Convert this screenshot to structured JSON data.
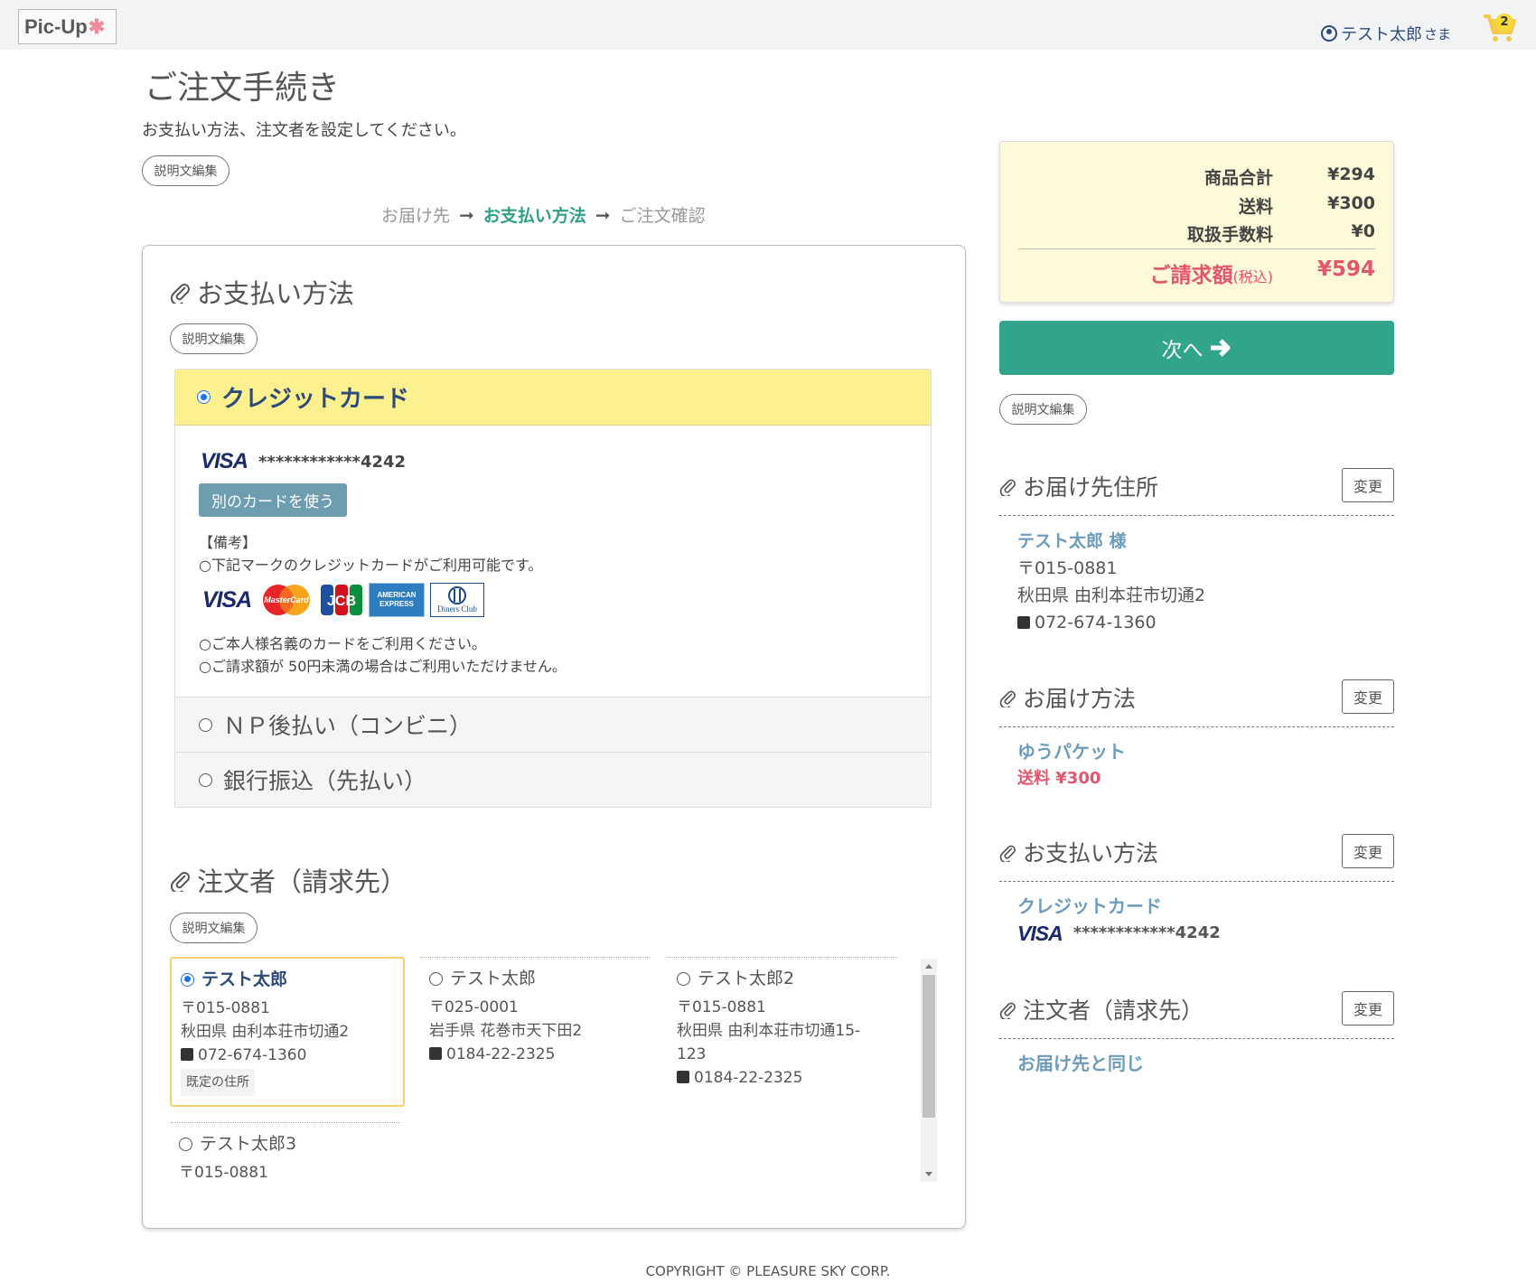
{
  "header": {
    "logo_text": "Pic-Up",
    "user_name": "テスト太郎",
    "user_suffix": "さま",
    "cart_count": "2"
  },
  "page": {
    "title": "ご注文手続き",
    "intro": "お支払い方法、注文者を設定してください。",
    "edit_label": "説明文編集"
  },
  "steps": {
    "step1": "お届け先",
    "step2": "お支払い方法",
    "step3": "ご注文確認",
    "arrow": "➞"
  },
  "payment": {
    "title": "お支払い方法",
    "edit_label": "説明文編集",
    "selected_label": "クレジットカード",
    "card_brand": "VISA",
    "card_number": "************4242",
    "alt_card_button": "別のカードを使う",
    "note_head": "【備考】",
    "note1": "○下記マークのクレジットカードがご利用可能です。",
    "note2": "○ご本人様名義のカードをご利用ください。",
    "note3": "○ご請求額が 50円未満の場合はご利用いただけません。",
    "brands": {
      "visa": "VISA",
      "mc": "MasterCard",
      "jcb": "JCB",
      "amex1": "AMERICAN",
      "amex2": "EXPRESS",
      "diners": "Diners Club"
    },
    "opt2": "ＮＰ後払い（コンビニ）",
    "opt3": "銀行振込（先払い）"
  },
  "orderer": {
    "title": "注文者（請求先）",
    "edit_label": "説明文編集",
    "addresses": [
      {
        "name": "テスト太郎",
        "zip": "〒015-0881",
        "addr": "秋田県 由利本荘市切通2",
        "tel": "072-674-1360",
        "default": "既定の住所"
      },
      {
        "name": "テスト太郎",
        "zip": "〒025-0001",
        "addr": "岩手県 花巻市天下田2",
        "tel": "0184-22-2325"
      },
      {
        "name": "テスト太郎2",
        "zip": "〒015-0881",
        "addr": "秋田県 由利本荘市切通15-123",
        "tel": "0184-22-2325"
      },
      {
        "name": "テスト太郎3",
        "zip": "〒015-0881"
      }
    ]
  },
  "summary": {
    "subtotal_label": "商品合計",
    "subtotal": "¥294",
    "shipping_label": "送料",
    "shipping": "¥300",
    "fee_label": "取扱手数料",
    "fee": "¥0",
    "total_label": "ご請求額",
    "total_tax": "(税込)",
    "total": "¥594"
  },
  "next_button": "次へ",
  "side": {
    "edit_label": "説明文編集",
    "change_label": "変更",
    "delivery_addr": {
      "title": "お届け先住所",
      "name": "テスト太郎 様",
      "zip": "〒015-0881",
      "addr": "秋田県 由利本荘市切通2",
      "tel": "072-674-1360"
    },
    "delivery_method": {
      "title": "お届け方法",
      "name": "ゆうパケット",
      "fee": "送料 ¥300"
    },
    "payment": {
      "title": "お支払い方法",
      "name": "クレジットカード",
      "brand": "VISA",
      "number": "************4242"
    },
    "orderer": {
      "title": "注文者（請求先）",
      "value": "お届け先と同じ"
    }
  },
  "footer": "COPYRIGHT © PLEASURE SKY CORP.",
  "colors": {
    "accent": "#31a58b",
    "brand_blue": "#2d4a7a",
    "price_red": "#e2566e",
    "highlight_yellow": "#fdf08f"
  }
}
